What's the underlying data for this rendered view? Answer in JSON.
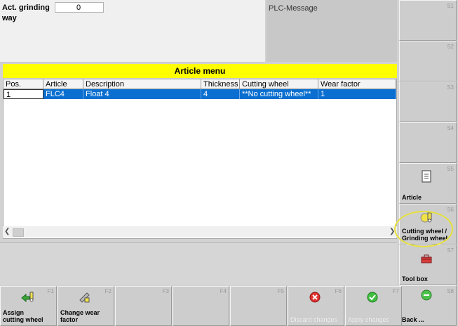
{
  "top": {
    "act_grinding_way_label": "Act. grinding way",
    "act_grinding_way_value": "0",
    "plc_message_label": "PLC-Message"
  },
  "article_menu": {
    "title": "Article menu",
    "columns": [
      "Pos.",
      "Article",
      "Description",
      "Thickness [in",
      "Cutting wheel",
      "Wear factor"
    ],
    "rows": [
      {
        "pos": "1",
        "article": "FLC4",
        "description": "Float 4",
        "thickness": "4",
        "cutting_wheel": "**No cutting wheel**",
        "wear_factor": "1"
      }
    ]
  },
  "right_softkeys": [
    {
      "num": "S1",
      "label": ""
    },
    {
      "num": "S2",
      "label": ""
    },
    {
      "num": "S3",
      "label": ""
    },
    {
      "num": "S4",
      "label": ""
    },
    {
      "num": "S5",
      "label": "Article",
      "icon": "article-icon"
    },
    {
      "num": "S6",
      "label": "Cutting wheel /\nGrinding wheel",
      "icon": "cutting-grinding-wheel-icon"
    },
    {
      "num": "S7",
      "label": "Tool box",
      "icon": "tool-box-icon"
    },
    {
      "num": "S8",
      "label": "Back ...",
      "icon": "back-icon"
    }
  ],
  "bottom_softkeys": [
    {
      "num": "F1",
      "label": "Assign\ncutting wheel",
      "icon": "assign-arrow-icon"
    },
    {
      "num": "F2",
      "label": "Change wear\nfactor",
      "icon": "change-wear-icon"
    },
    {
      "num": "F3",
      "label": ""
    },
    {
      "num": "F4",
      "label": ""
    },
    {
      "num": "F5",
      "label": ""
    },
    {
      "num": "F6",
      "label": "Discard changes",
      "icon": "discard-icon",
      "enabled": false
    },
    {
      "num": "F7",
      "label": "Apply changes",
      "icon": "apply-icon",
      "enabled": false
    }
  ],
  "colors": {
    "title_bar": "#ffff00",
    "selected_row": "#0a6fd0",
    "highlight": "#e7e13f"
  }
}
